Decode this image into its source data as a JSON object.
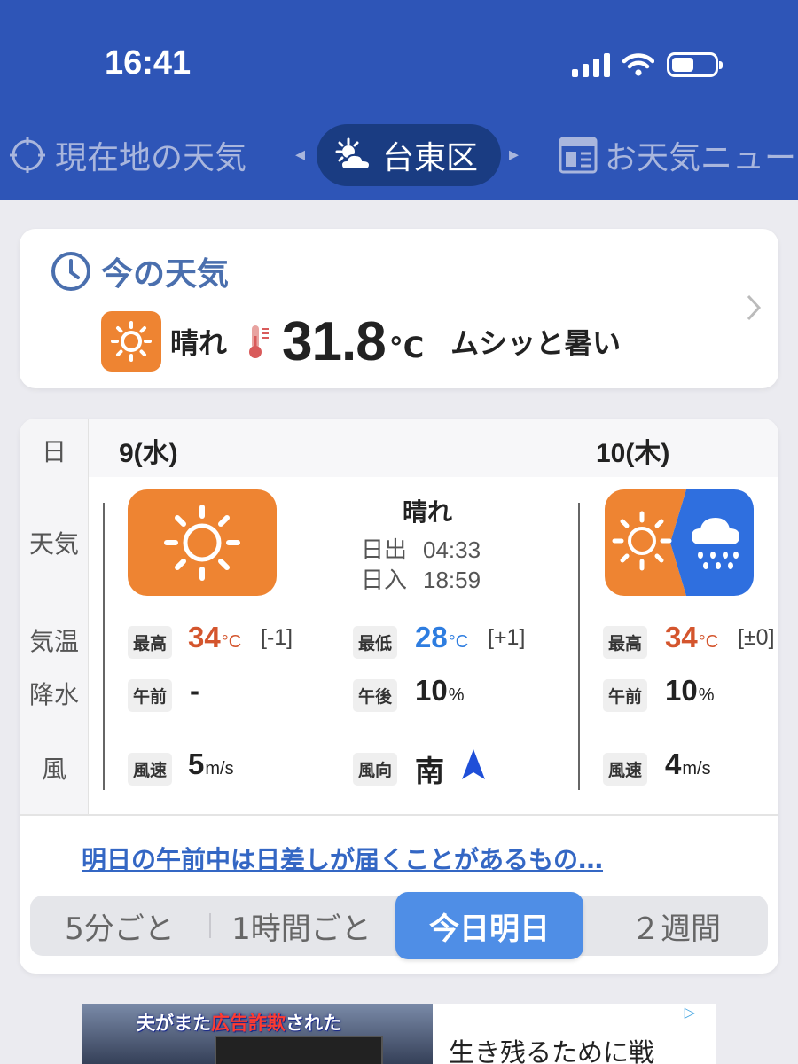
{
  "status_bar": {
    "time": "16:41",
    "battery_percent": 50
  },
  "nav": {
    "current_location": "現在地の天気",
    "active_location": "台東区",
    "news": "お天気ニュー",
    "prev_arrow": "◂",
    "next_arrow": "▸"
  },
  "now": {
    "title": "今の天気",
    "condition": "晴れ",
    "temperature": "31.8",
    "unit": "°C",
    "feel": "ムシッと暑い",
    "icons": [
      "clock-icon",
      "sun-icon",
      "thermometer-icon",
      "chevron-right-icon"
    ]
  },
  "forecast": {
    "row_labels": {
      "day": "日",
      "weather": "天気",
      "temp": "気温",
      "precip": "降水",
      "wind": "風"
    },
    "day1": {
      "date": "9(水)",
      "condition": "晴れ",
      "sunrise_label": "日出",
      "sunrise": "04:33",
      "sunset_label": "日入",
      "sunset": "18:59",
      "high_label": "最高",
      "high": "34",
      "high_diff": "[-1]",
      "low_label": "最低",
      "low": "28",
      "low_diff": "[+1]",
      "am_label": "午前",
      "am_precip": "-",
      "pm_label": "午後",
      "pm_precip": "10",
      "wind_speed_label": "風速",
      "wind_speed": "5",
      "wind_dir_label": "風向",
      "wind_dir": "南"
    },
    "day2": {
      "date": "10(木)",
      "high_label": "最高",
      "high": "34",
      "high_diff": "[±0]",
      "am_label": "午前",
      "am_precip": "10",
      "wind_speed_label": "風速",
      "wind_speed": "4"
    },
    "units": {
      "temp": "°C",
      "percent": "%",
      "wind": "m/s"
    },
    "link_text": "明日の午前中は日差しが届くことがあるもの…"
  },
  "segments": {
    "items": [
      "5分ごと",
      "1時間ごと",
      "今日明日",
      "２週間"
    ],
    "active": "今日明日"
  },
  "ad": {
    "caption_1": "夫がまた",
    "caption_2": "広告詐欺",
    "caption_3": "された",
    "text": "生き残るために戦",
    "badge": "▷"
  },
  "colors": {
    "header": "#2e55b7",
    "active_pill": "#1a3c82",
    "sun_orange": "#ee8432",
    "rain_blue": "#2f6fdf",
    "high_red": "#d4552d",
    "low_blue": "#2e7de0",
    "segment_active": "#4f8ee6"
  }
}
